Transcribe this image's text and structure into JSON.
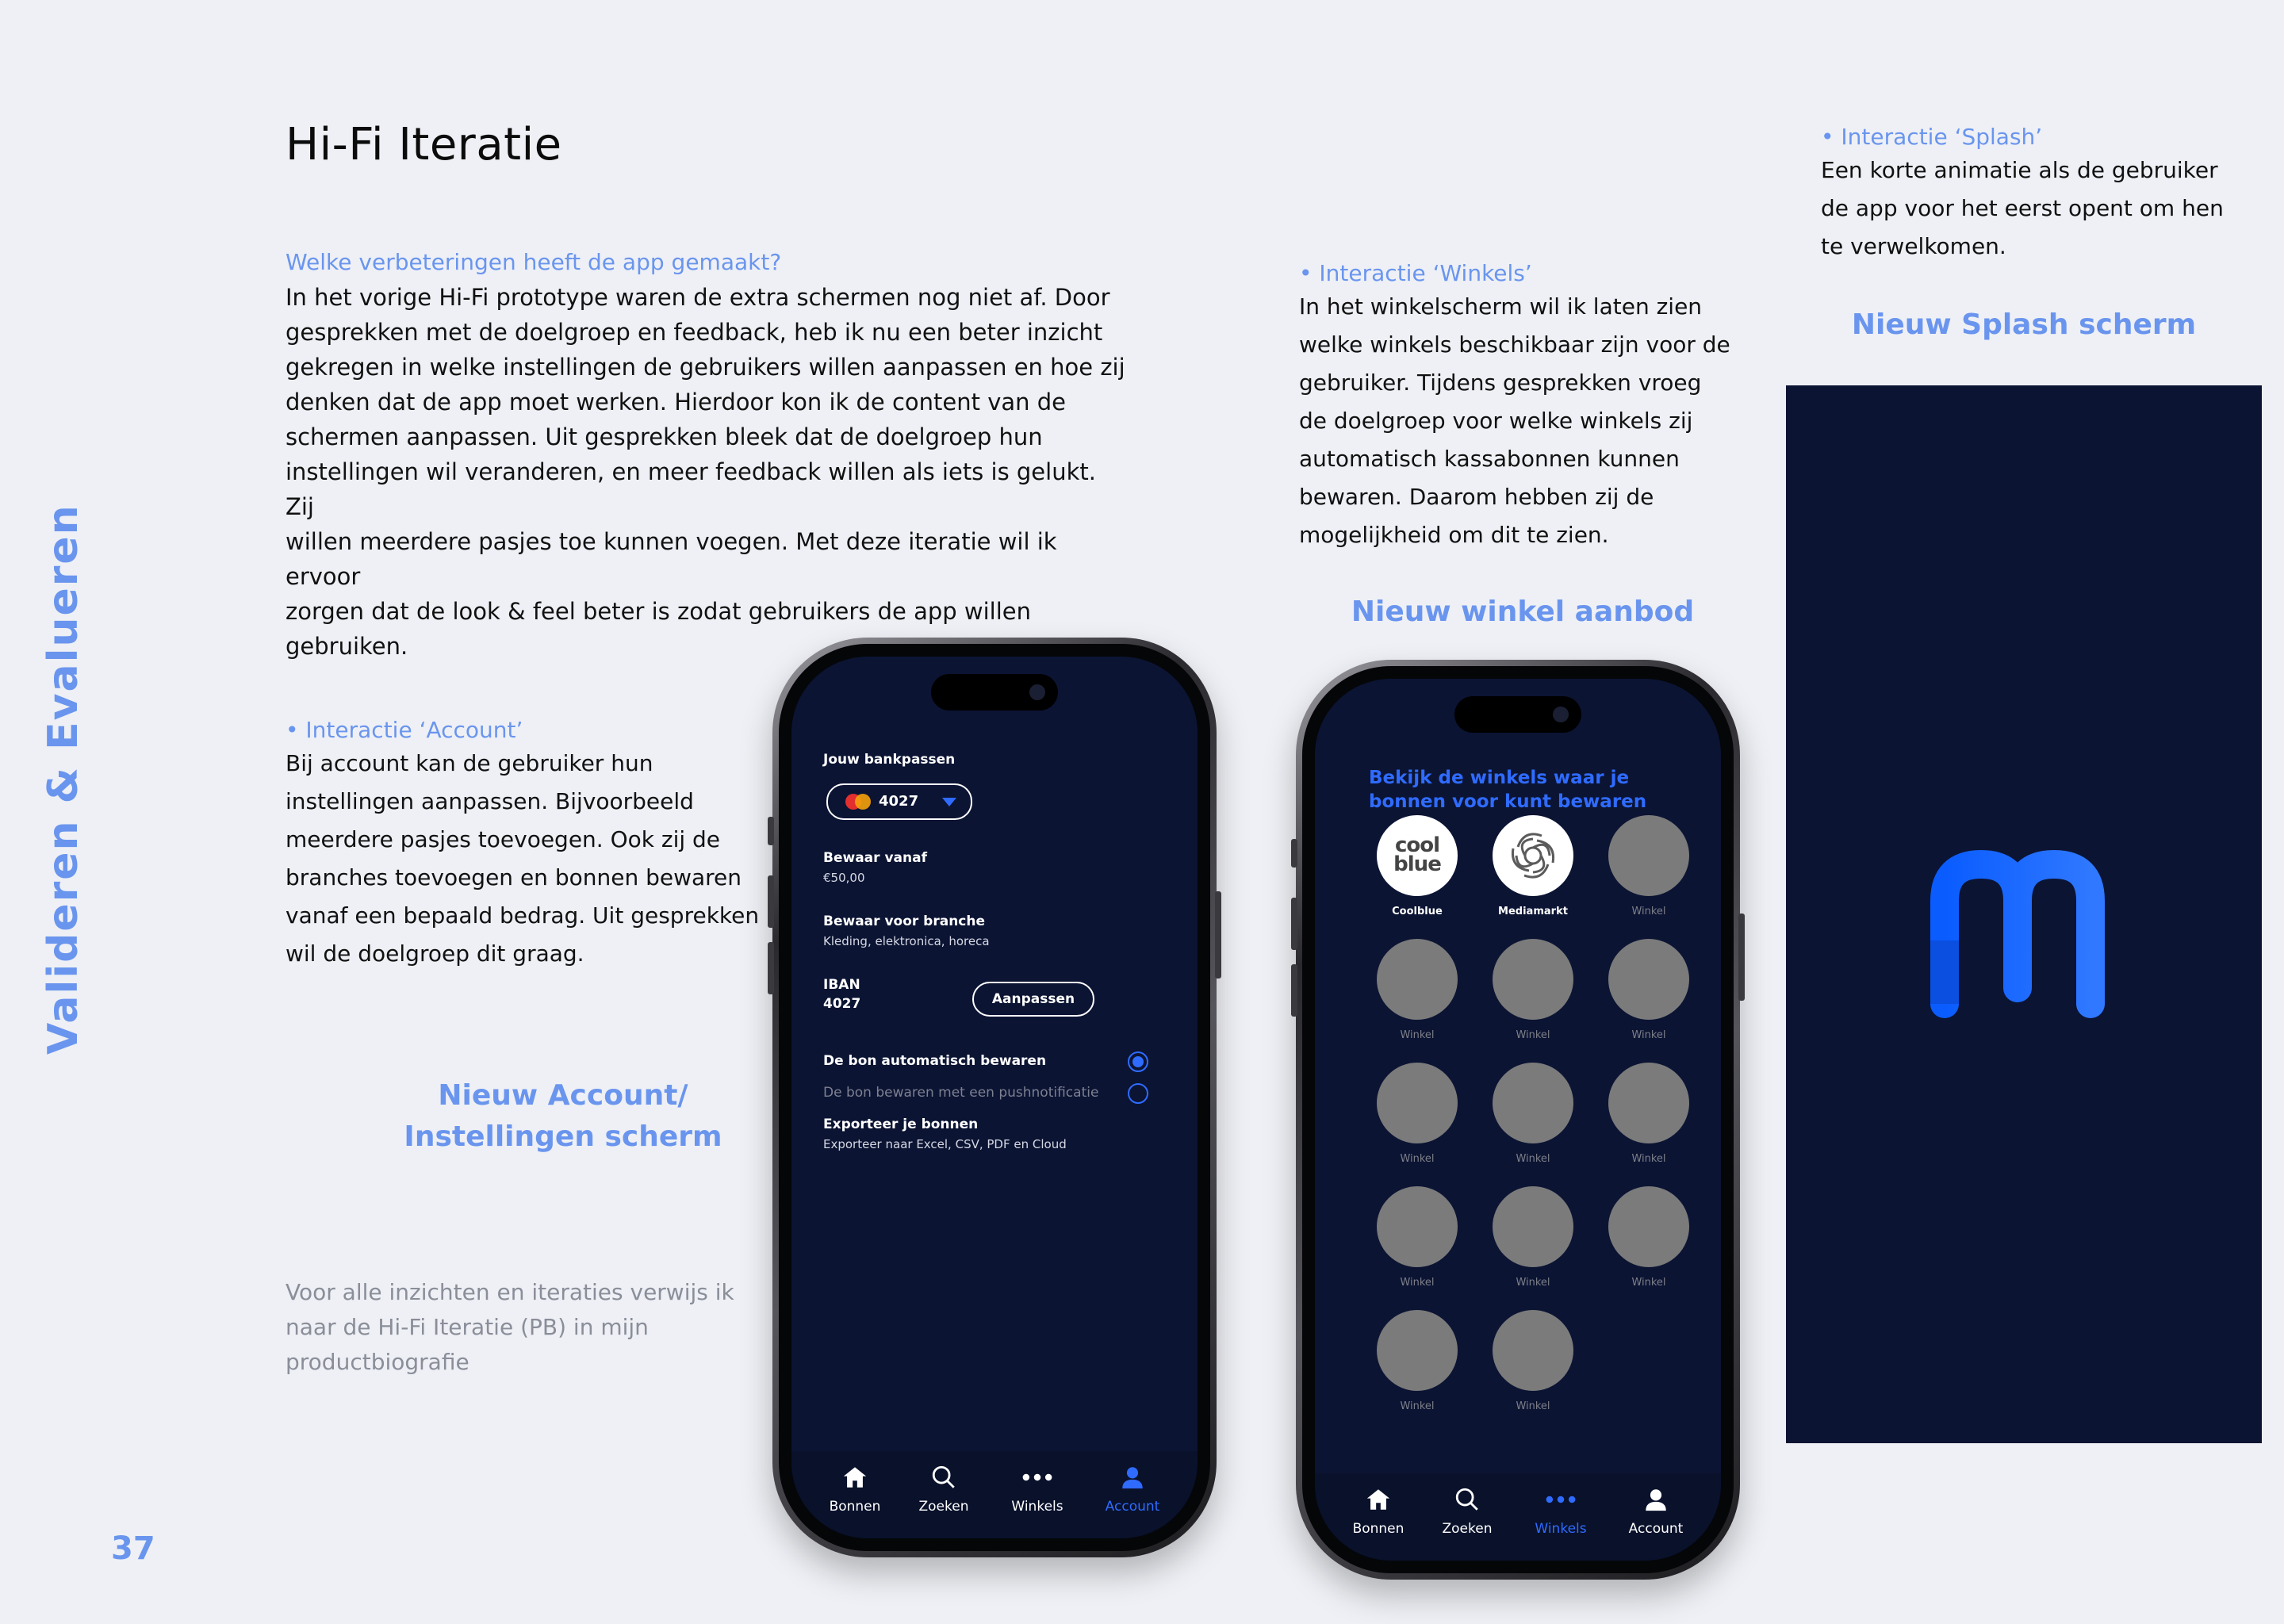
{
  "page": {
    "title": "Hi-Fi Iteratie",
    "side_title": "Valideren & Evalueren",
    "page_number": "37"
  },
  "intro": {
    "question": "Welke verbeteringen heeft de app gemaakt?",
    "lines": [
      "In het vorige Hi-Fi prototype waren de extra schermen nog niet af. Door",
      "gesprekken met de doelgroep en feedback, heb ik nu een beter inzicht",
      "gekregen in welke instellingen de gebruikers willen aanpassen en hoe zij",
      "denken dat de app moet werken. Hierdoor kon ik de content van de",
      "schermen aanpassen. Uit gesprekken bleek dat de doelgroep hun",
      "instellingen wil veranderen, en meer feedback willen als iets is gelukt. Zij",
      "willen meerdere pasjes toe kunnen voegen. Met deze iteratie wil ik ervoor",
      "zorgen dat de look & feel beter is zodat gebruikers de app willen gebruiken."
    ]
  },
  "account_section": {
    "heading": "• Interactie ‘Account’",
    "lines": [
      "Bij account kan de gebruiker hun",
      "instellingen aanpassen. Bijvoorbeeld",
      "meerdere pasjes toevoegen. Ook zij de",
      "branches toevoegen en bonnen bewaren",
      "vanaf een bepaald bedrag. Uit gesprekken",
      "wil de doelgroep dit graag."
    ],
    "caption_line1": "Nieuw Account/",
    "caption_line2": "Instellingen scherm"
  },
  "note": {
    "lines": [
      "Voor alle inzichten en iteraties verwijs ik",
      "naar de Hi-Fi Iteratie (PB) in mijn",
      "productbiografie"
    ]
  },
  "winkels_section": {
    "heading": "• Interactie ‘Winkels’",
    "lines": [
      "In het winkelscherm wil ik laten zien",
      "welke winkels beschikbaar zijn voor de",
      "gebruiker. Tijdens gesprekken vroeg",
      "de doelgroep voor welke winkels zij",
      "automatisch kassabonnen kunnen",
      "bewaren. Daarom hebben zij de",
      "mogelijkheid om dit te zien."
    ],
    "caption": "Nieuw winkel aanbod"
  },
  "splash_section": {
    "heading": "• Interactie ‘Splash’",
    "lines": [
      "Een korte animatie als de gebruiker",
      "de app voor het eerst opent om hen",
      "te verwelkomen."
    ],
    "caption": "Nieuw Splash scherm"
  },
  "account_screen": {
    "cards_label": "Jouw bankpassen",
    "card_number": "4027",
    "save_from_label": "Bewaar vanaf",
    "save_from_value": "€50,00",
    "branch_label": "Bewaar voor branche",
    "branch_value": "Kleding, elektronica, horeca",
    "iban_label": "IBAN",
    "iban_value": "4027",
    "adjust_button": "Aanpassen",
    "option_auto": "De bon automatisch bewaren",
    "option_auto_selected": true,
    "option_push": "De bon bewaren met een pushnotificatie",
    "option_push_selected": false,
    "export_label": "Exporteer je bonnen",
    "export_value": "Exporteer naar Excel, CSV, PDF en Cloud"
  },
  "account_tabbar": {
    "tabs": [
      {
        "label": "Bonnen",
        "icon": "home-icon"
      },
      {
        "label": "Zoeken",
        "icon": "search-icon"
      },
      {
        "label": "Winkels",
        "icon": "more-dots-icon"
      },
      {
        "label": "Account",
        "icon": "user-icon"
      }
    ],
    "active": "Account",
    "active_color": "#2f6bff"
  },
  "stores_screen": {
    "title": "Bekijk de winkels waar je bonnen voor kunt bewaren",
    "stores": [
      {
        "name": "Coolblue",
        "logo_text": "cool blue",
        "logo": true
      },
      {
        "name": "Mediamarkt",
        "logo": true
      },
      {
        "name": "Winkel"
      },
      {
        "name": "Winkel"
      },
      {
        "name": "Winkel"
      },
      {
        "name": "Winkel"
      },
      {
        "name": "Winkel"
      },
      {
        "name": "Winkel"
      },
      {
        "name": "Winkel"
      },
      {
        "name": "Winkel"
      },
      {
        "name": "Winkel"
      },
      {
        "name": "Winkel"
      },
      {
        "name": "Winkel"
      },
      {
        "name": "Winkel"
      }
    ]
  },
  "stores_tabbar": {
    "tabs": [
      {
        "label": "Bonnen",
        "icon": "home-icon"
      },
      {
        "label": "Zoeken",
        "icon": "search-icon"
      },
      {
        "label": "Winkels",
        "icon": "more-dots-icon"
      },
      {
        "label": "Account",
        "icon": "user-icon"
      }
    ],
    "active": "Winkels"
  },
  "colors": {
    "accent": "#6a95ee",
    "app_blue": "#2f6bff",
    "screen_bg": "#0b1433",
    "page_bg": "#eef0f5"
  }
}
